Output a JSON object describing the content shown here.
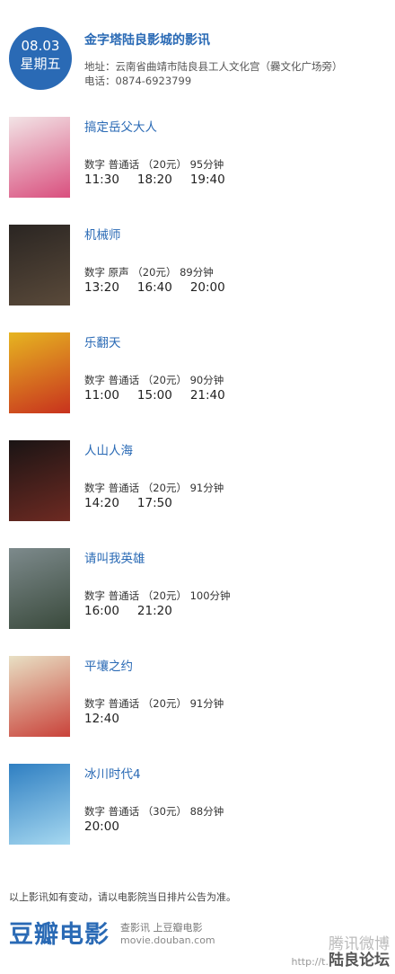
{
  "header": {
    "date": "08.03",
    "weekday": "星期五",
    "cinema_name": "金字塔陆良影城的影讯",
    "address": "地址：云南省曲靖市陆良县工人文化宫（爨文化广场旁）",
    "phone": "电话：0874-6923799"
  },
  "movies": [
    {
      "title": "搞定岳父大人",
      "info": "数字  普通话 （20元） 95分钟",
      "times": [
        "11:30",
        "18:20",
        "19:40"
      ],
      "poster_colors": [
        "#f2e4e6",
        "#d94f7e"
      ]
    },
    {
      "title": "机械师",
      "info": "数字  原声 （20元） 89分钟",
      "times": [
        "13:20",
        "16:40",
        "20:00"
      ],
      "poster_colors": [
        "#2a2522",
        "#5a4a3a"
      ]
    },
    {
      "title": "乐翻天",
      "info": "数字  普通话 （20元） 90分钟",
      "times": [
        "11:00",
        "15:00",
        "21:40"
      ],
      "poster_colors": [
        "#e6b521",
        "#c8321e"
      ]
    },
    {
      "title": "人山人海",
      "info": "数字  普通话 （20元） 91分钟",
      "times": [
        "14:20",
        "17:50"
      ],
      "poster_colors": [
        "#1a1414",
        "#6e2a22"
      ]
    },
    {
      "title": "请叫我英雄",
      "info": "数字  普通话 （20元） 100分钟",
      "times": [
        "16:00",
        "21:20"
      ],
      "poster_colors": [
        "#7d8a8c",
        "#3a4a3c"
      ]
    },
    {
      "title": "平壤之约",
      "info": "数字  普通话 （20元） 91分钟",
      "times": [
        "12:40"
      ],
      "poster_colors": [
        "#e8e0c4",
        "#c9423a"
      ]
    },
    {
      "title": "冰川时代4",
      "info": "数字  普通话 （30元） 88分钟",
      "times": [
        "20:00"
      ],
      "poster_colors": [
        "#2f7fc2",
        "#a6d8f0"
      ]
    }
  ],
  "footer": {
    "notice": "以上影讯如有变动，请以电影院当日排片公告为准。",
    "logo": "豆瓣电影",
    "slogan": "查影讯  上豆瓣电影",
    "site": "movie.douban.com"
  },
  "watermark": {
    "weibo": "腾讯微博",
    "url": "http://t.",
    "forum": "陆良论坛"
  }
}
